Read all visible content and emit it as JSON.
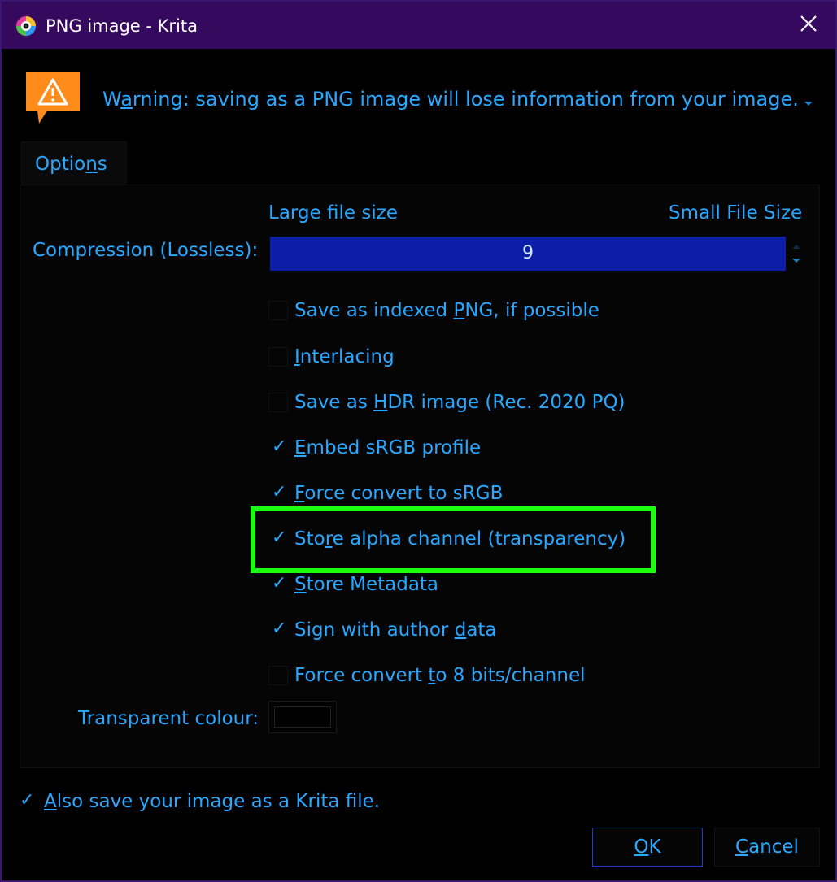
{
  "window": {
    "title": "PNG image - Krita",
    "title_icon": "krita-logo-icon",
    "close_icon": "close-icon"
  },
  "warning": {
    "icon": "warning-icon",
    "text_prefix": "W",
    "text_underlined": "a",
    "text_rest": "rning: saving as a PNG image will lose information from your image.",
    "dropdown_icon": "chevron-down-icon"
  },
  "tabs": [
    {
      "label_pre": "Optio",
      "label_ul": "n",
      "label_post": "s"
    }
  ],
  "compression": {
    "label": "Compression (Lossless):",
    "large_label": "Large file size",
    "small_label": "Small File Size",
    "value": "9"
  },
  "checkboxes": [
    {
      "pre": "Save as indexed ",
      "ul": "P",
      "post": "NG, if possible",
      "checked": false
    },
    {
      "pre": "",
      "ul": "I",
      "post": "nterlacing",
      "checked": false
    },
    {
      "pre": "Save as ",
      "ul": "H",
      "post": "DR image (Rec. 2020 PQ)",
      "checked": false
    },
    {
      "pre": "",
      "ul": "E",
      "post": "mbed sRGB profile",
      "checked": true
    },
    {
      "pre": "",
      "ul": "F",
      "post": "orce convert to sRGB",
      "checked": true
    },
    {
      "pre": "Sto",
      "ul": "r",
      "post": "e alpha channel (transparency)",
      "checked": true
    },
    {
      "pre": "",
      "ul": "S",
      "post": "tore Metadata",
      "checked": true
    },
    {
      "pre": "Sign with author ",
      "ul": "d",
      "post": "ata",
      "checked": true
    },
    {
      "pre": "Force convert ",
      "ul": "t",
      "post": "o 8 bits/channel",
      "checked": false
    }
  ],
  "transparent": {
    "label": "Transparent colour:",
    "swatch_color": "#000000"
  },
  "also_save": {
    "ul": "A",
    "post": "lso save your image as a Krita file.",
    "checked": true
  },
  "buttons": {
    "ok_ul": "O",
    "ok_post": "K",
    "cancel_ul": "C",
    "cancel_post": "ancel"
  },
  "check_mark": "✓",
  "colors": {
    "text": "#2aa7ff",
    "titlebar": "#350a5e",
    "spin_fill": "#0c1ea8",
    "highlight": "#1aff12",
    "warning": "#ff8c1a"
  }
}
